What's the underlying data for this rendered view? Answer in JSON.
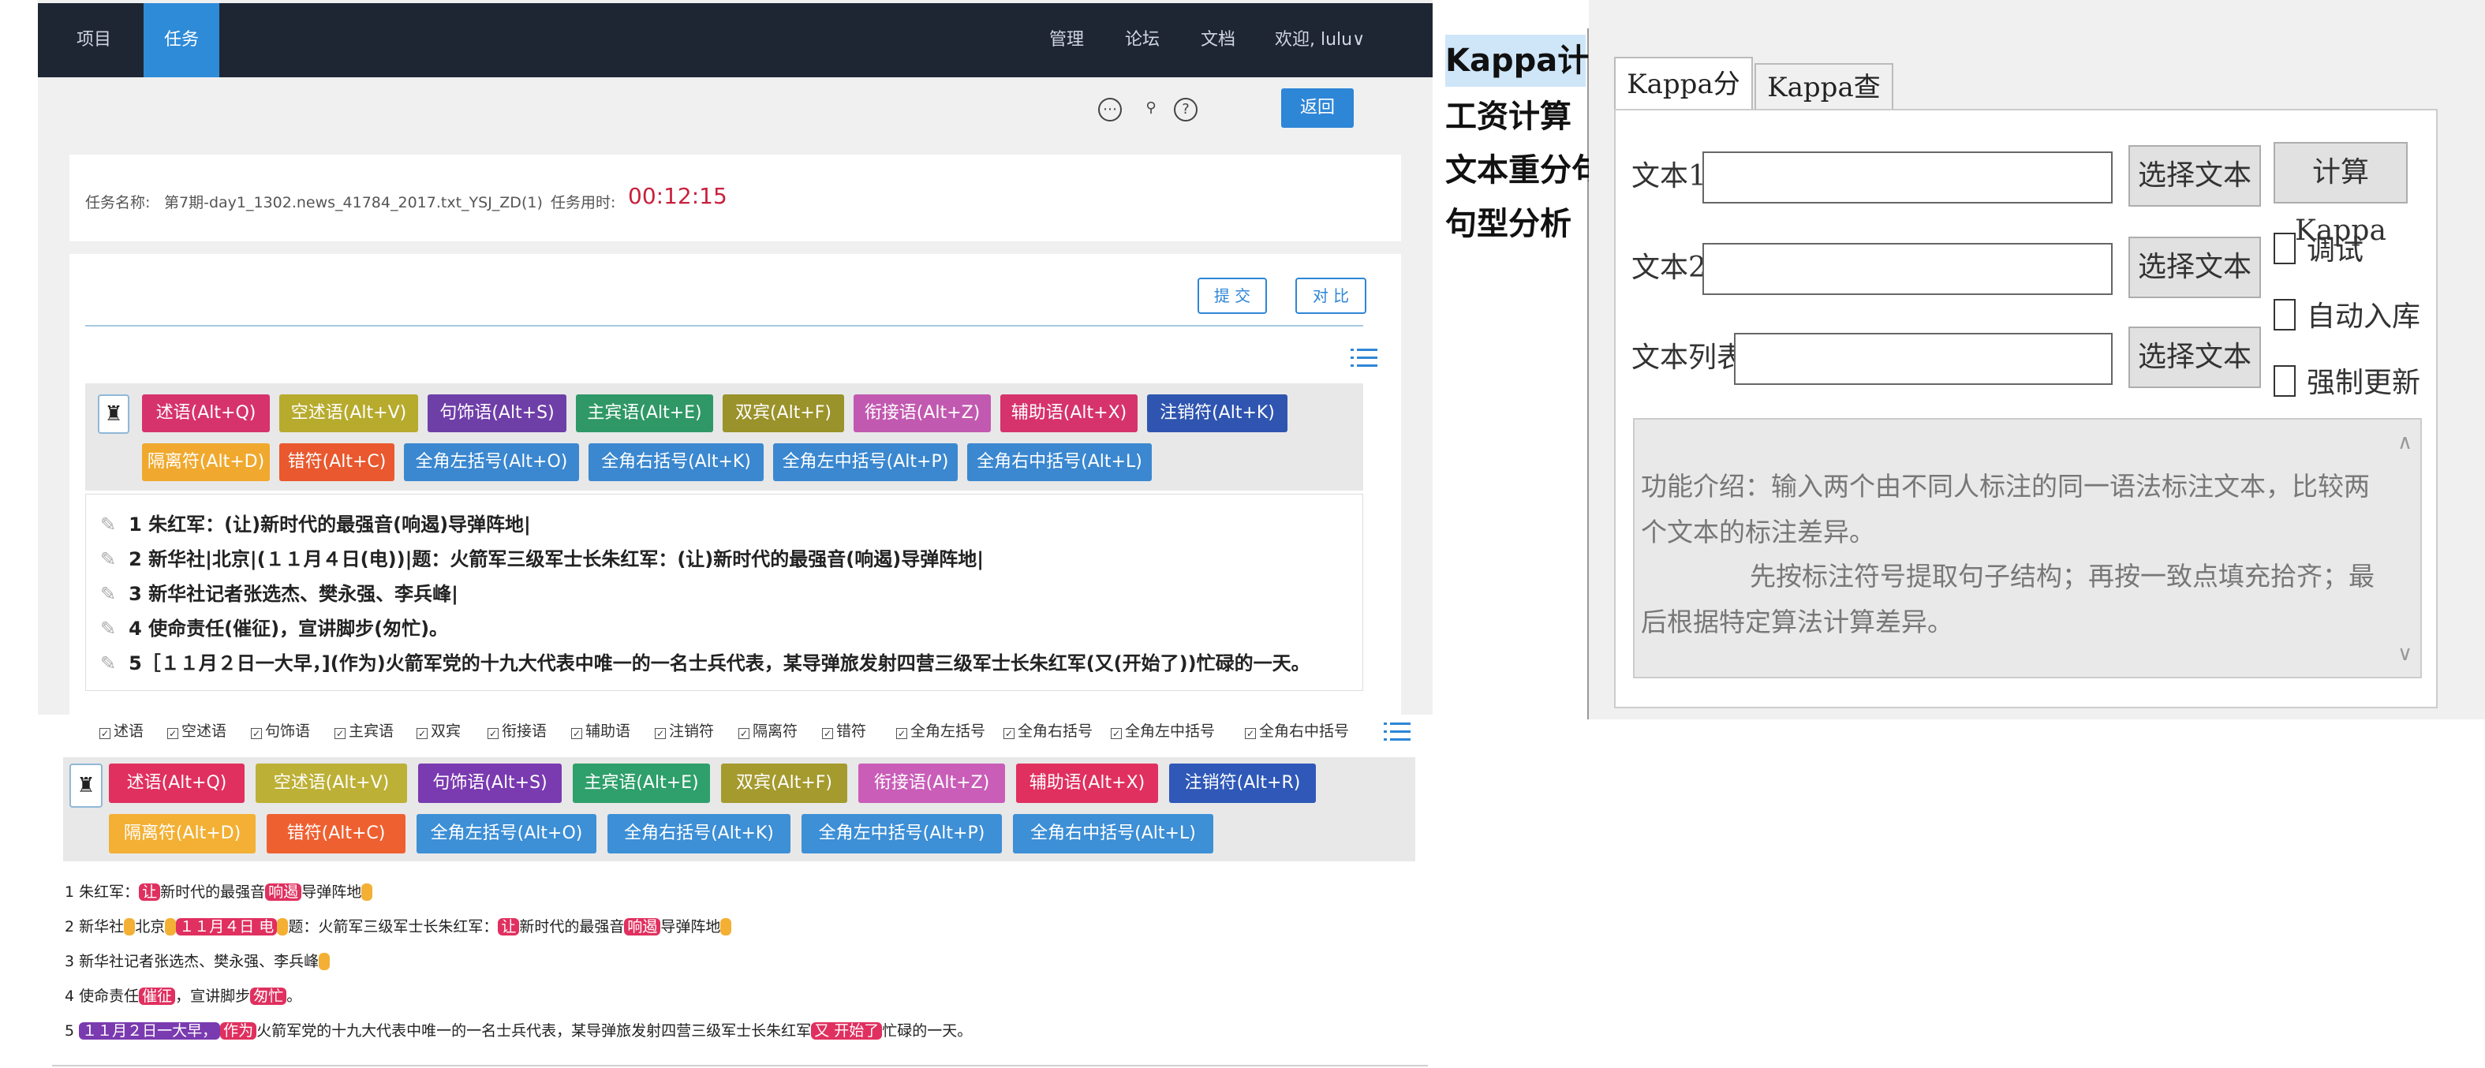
{
  "nav": {
    "tabs": [
      "项目",
      "任务"
    ],
    "right": [
      "管理",
      "论坛",
      "文档",
      "欢迎, lulu∨"
    ]
  },
  "toolbar": {
    "back_label": "返回"
  },
  "task": {
    "name_label": "任务名称:",
    "name_value": "第7期-day1_1302.news_41784_2017.txt_YSJ_ZD(1)",
    "time_label": "任务用时:",
    "time_value": "00:12:15"
  },
  "actions": {
    "submit": "提 交",
    "compare": "对 比"
  },
  "tags_top": [
    {
      "label": "述语(Alt+Q)",
      "color": "#d6336c"
    },
    {
      "label": "空述语(Alt+V)",
      "color": "#b7ab2e"
    },
    {
      "label": "句饰语(Alt+S)",
      "color": "#6f3fa8"
    },
    {
      "label": "主宾语(Alt+E)",
      "color": "#2f9866"
    },
    {
      "label": "双宾(Alt+F)",
      "color": "#9a922a"
    },
    {
      "label": "衔接语(Alt+Z)",
      "color": "#c259b0"
    },
    {
      "label": "辅助语(Alt+X)",
      "color": "#d6336c"
    },
    {
      "label": "注销符(Alt+K)",
      "color": "#2f55b0"
    },
    {
      "label": "隔离符(Alt+D)",
      "color": "#f0a92e"
    },
    {
      "label": "错符(Alt+C)",
      "color": "#e9582e"
    },
    {
      "label": "全角左括号(Alt+O)",
      "color": "#3b88d0"
    },
    {
      "label": "全角右括号(Alt+K)",
      "color": "#3b88d0"
    },
    {
      "label": "全角左中括号(Alt+P)",
      "color": "#3b88d0"
    },
    {
      "label": "全角右中括号(Alt+L)",
      "color": "#3b88d0"
    }
  ],
  "sentences_top": [
    "1 朱红军：(让)新时代的最强音(响遏)导弹阵地|",
    "2 新华社|北京|(１１月４日(电))|题：火箭军三级军士长朱红军：(让)新时代的最强音(响遏)导弹阵地|",
    "3 新华社记者张选杰、樊永强、李兵峰|",
    "4 使命责任(催征)，宣讲脚步(匆忙)。",
    "5［１１月２日一大早，](作为)火箭军党的十九大代表中唯一的一名士兵代表，某导弹旅发射四营三级军士长朱红军(又(开始了))忙碌的一天。"
  ],
  "checkboxes": [
    "述语",
    "空述语",
    "句饰语",
    "主宾语",
    "双宾",
    "衔接语",
    "辅助语",
    "注销符",
    "隔离符",
    "错符",
    "全角左括号",
    "全角右括号",
    "全角左中括号",
    "全角右中括号"
  ],
  "tags_bottom": [
    {
      "label": "述语(Alt+Q)",
      "color": "#e0305f"
    },
    {
      "label": "空述语(Alt+V)",
      "color": "#bdb036"
    },
    {
      "label": "句饰语(Alt+S)",
      "color": "#7a3ab0"
    },
    {
      "label": "主宾语(Alt+E)",
      "color": "#2fa06b"
    },
    {
      "label": "双宾(Alt+F)",
      "color": "#a49a2e"
    },
    {
      "label": "衔接语(Alt+Z)",
      "color": "#c95db8"
    },
    {
      "label": "辅助语(Alt+X)",
      "color": "#e0305f"
    },
    {
      "label": "注销符(Alt+R)",
      "color": "#2f58b8"
    },
    {
      "label": "隔离符(Alt+D)",
      "color": "#f3b034"
    },
    {
      "label": "错符(Alt+C)",
      "color": "#ef6030"
    },
    {
      "label": "全角左括号(Alt+O)",
      "color": "#3d8fd6"
    },
    {
      "label": "全角右括号(Alt+K)",
      "color": "#3d8fd6"
    },
    {
      "label": "全角左中括号(Alt+P)",
      "color": "#3d8fd6"
    },
    {
      "label": "全角右中括号(Alt+L)",
      "color": "#3d8fd6"
    }
  ],
  "sentences_bottom": {
    "s1": [
      "1 朱红军：",
      "让",
      "新时代的最强音",
      "响遏",
      "导弹阵地"
    ],
    "s2": [
      "2 新华社",
      "北京",
      "１１月４日 电",
      "题：火箭军三级军士长朱红军：",
      "让",
      "新时代的最强音",
      "响遏",
      "导弹阵地"
    ],
    "s3": [
      "3 新华社记者张选杰、樊永强、李兵峰"
    ],
    "s4": [
      "4 使命责任",
      "催征",
      "，宣讲脚步",
      "匆忙",
      "。"
    ],
    "s5": [
      "5 ",
      "１１月２日一大早，",
      "作为",
      "火箭军党的十九大代表中唯一的一名士兵代表，某导弹旅发射四营三级军士长朱红军",
      "又 开始了",
      "忙碌的一天。"
    ]
  },
  "kappa": {
    "menu": [
      "Kappa计算",
      "工资计算",
      "文本重分句",
      "句型分析"
    ],
    "tabs": [
      "Kappa分析",
      "Kappa查询"
    ],
    "text1_label": "文本1:",
    "text2_label": "文本2:",
    "textlist_label": "文本列表:",
    "choose_btn": "选择文本",
    "calc_btn": "计算Kappa",
    "checks": [
      "调试",
      "自动入库",
      "强制更新"
    ],
    "desc1": "功能介绍：输入两个由不同人标注的同一语法标注文本，比较两个文本的标注差异。",
    "desc2": "先按标注符号提取句子结构；再按一致点填充拾齐；最后根据特定算法计算差异。"
  }
}
